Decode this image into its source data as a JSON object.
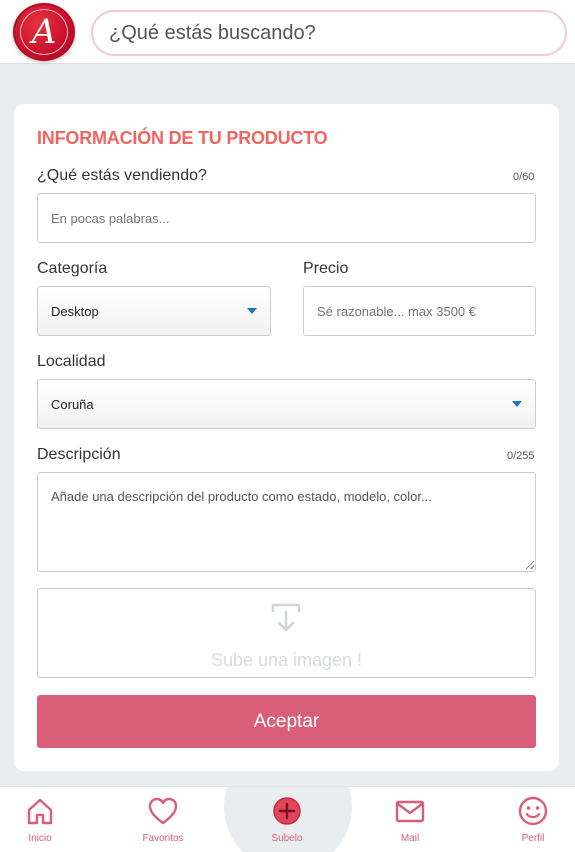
{
  "header": {
    "logo_letter": "A",
    "search_placeholder": "¿Qué estás buscando?"
  },
  "form": {
    "title": "INFORMACIÓN DE TU PRODUCTO",
    "selling": {
      "label": "¿Qué estás vendiendo?",
      "counter": "0/60",
      "placeholder": "En pocas palabras..."
    },
    "category": {
      "label": "Categoría",
      "selected": "Desktop"
    },
    "price": {
      "label": "Precio",
      "placeholder": "Sé razonable... max 3500 €"
    },
    "location": {
      "label": "Localidad",
      "selected": "Coruña"
    },
    "description": {
      "label": "Descripción",
      "counter": "0/255",
      "placeholder": "Añade una descripción del producto como estado, modelo, color..."
    },
    "upload": {
      "label": "Sube una imagen !",
      "icon": "upload-icon"
    },
    "submit_label": "Aceptar"
  },
  "bottom_nav": {
    "items": [
      {
        "label": "Inicio",
        "icon": "home-icon"
      },
      {
        "label": "Favoritos",
        "icon": "heart-icon"
      },
      {
        "label": "Subelo",
        "icon": "add-circle-icon"
      },
      {
        "label": "Mail",
        "icon": "mail-icon"
      },
      {
        "label": "Perfil",
        "icon": "smiley-icon"
      }
    ]
  },
  "colors": {
    "accent": "#d95e78",
    "title": "#f0655f",
    "select_caret": "#1a78c2",
    "background": "#eaedf0"
  }
}
